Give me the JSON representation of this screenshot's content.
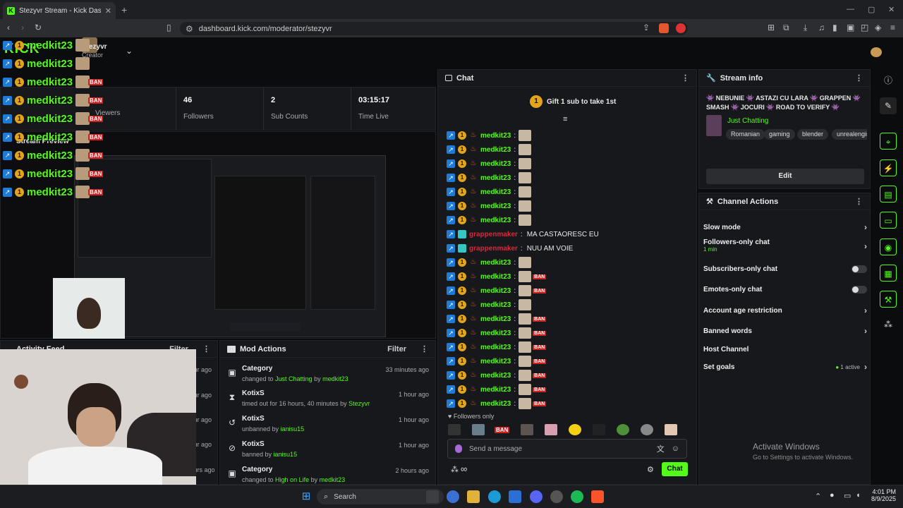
{
  "browser": {
    "tab_title": "Stezyvr Stream - Kick Dashboard",
    "url": "dashboard.kick.com/moderator/stezyvr"
  },
  "nav": {
    "username": "Stezyvr",
    "role": "Creator",
    "logo": "KICK"
  },
  "stats": [
    {
      "value": "",
      "label": "Viewers"
    },
    {
      "value": "46",
      "label": "Followers"
    },
    {
      "value": "2",
      "label": "Sub Counts"
    },
    {
      "value": "03:15:17",
      "label": "Time Live"
    }
  ],
  "stream_preview": {
    "title": "Stream Preview"
  },
  "overlay_chat": {
    "name": "medkit23",
    "count": 9
  },
  "chat": {
    "title": "Chat",
    "pinned": "Gift 1 sub to take 1st",
    "followers_only": "Followers only",
    "placeholder": "Send a message",
    "send_label": "Chat",
    "messages": [
      {
        "user": "medkit23",
        "text": "",
        "ban": false
      },
      {
        "user": "medkit23",
        "text": "",
        "ban": false
      },
      {
        "user": "medkit23",
        "text": "",
        "ban": false
      },
      {
        "user": "medkit23",
        "text": "",
        "ban": false
      },
      {
        "user": "medkit23",
        "text": "",
        "ban": false
      },
      {
        "user": "medkit23",
        "text": "",
        "ban": false
      },
      {
        "user": "medkit23",
        "text": "",
        "ban": false
      },
      {
        "user": "grappenmaker",
        "text": "MA CASTAORESC EU",
        "ban": false
      },
      {
        "user": "grappenmaker",
        "text": "NUU AM VOIE",
        "ban": false
      },
      {
        "user": "medkit23",
        "text": "",
        "ban": false
      },
      {
        "user": "medkit23",
        "text": "",
        "ban": true
      },
      {
        "user": "medkit23",
        "text": "",
        "ban": true
      },
      {
        "user": "medkit23",
        "text": "",
        "ban": false
      },
      {
        "user": "medkit23",
        "text": "",
        "ban": true
      },
      {
        "user": "medkit23",
        "text": "",
        "ban": true
      },
      {
        "user": "medkit23",
        "text": "",
        "ban": true
      },
      {
        "user": "medkit23",
        "text": "",
        "ban": true
      },
      {
        "user": "medkit23",
        "text": "",
        "ban": true
      },
      {
        "user": "medkit23",
        "text": "",
        "ban": true
      },
      {
        "user": "medkit23",
        "text": "",
        "ban": true
      }
    ]
  },
  "stream_info": {
    "title": "Stream info",
    "stream_title": "👾 NEBUNIE 👾 ASTAZI CU LARA 👾 GRAPPEN 👾 SMASH 👾 JOCURI 👾 ROAD TO VERIFY 👾",
    "category": "Just Chatting",
    "tags": [
      "Romanian",
      "gaming",
      "blender",
      "unrealengine"
    ],
    "edit_label": "Edit"
  },
  "channel_actions": {
    "title": "Channel Actions",
    "items": [
      {
        "label": "Slow mode",
        "sub": "",
        "control": "chevron"
      },
      {
        "label": "Followers-only chat",
        "sub": "1 min",
        "control": "chevron"
      },
      {
        "label": "Subscribers-only chat",
        "sub": "",
        "control": "toggle"
      },
      {
        "label": "Emotes-only chat",
        "sub": "",
        "control": "toggle"
      },
      {
        "label": "Account age restriction",
        "sub": "",
        "control": "chevron"
      },
      {
        "label": "Banned words",
        "sub": "",
        "control": "chevron"
      },
      {
        "label": "Host Channel",
        "sub": "",
        "control": "none"
      },
      {
        "label": "Set goals",
        "sub": "1 active",
        "control": "chevron"
      }
    ]
  },
  "activity_feed": {
    "title": "Activity Feed",
    "filter": "Filter",
    "times": [
      "1 hour ago",
      "1 hour ago",
      "1 hour ago",
      "1 hour ago",
      "1 hour ago",
      "2 hours ago"
    ]
  },
  "mod_actions": {
    "title": "Mod Actions",
    "filter": "Filter",
    "items": [
      {
        "title": "Category",
        "pre": "changed to ",
        "hl1": "Just Chatting",
        "mid": " by ",
        "hl2": "medkit23",
        "time": "33 minutes ago",
        "icon": "category-icon"
      },
      {
        "title": "KotixS",
        "pre": "timed out for 16 hours, 40 minutes by ",
        "hl1": "",
        "mid": "",
        "hl2": "Stezyvr",
        "time": "1 hour ago",
        "icon": "hourglass-icon"
      },
      {
        "title": "KotixS",
        "pre": "unbanned by ",
        "hl1": "",
        "mid": "",
        "hl2": "ianisu15",
        "time": "1 hour ago",
        "icon": "undo-icon"
      },
      {
        "title": "KotixS",
        "pre": "banned by ",
        "hl1": "",
        "mid": "",
        "hl2": "ianisu15",
        "time": "1 hour ago",
        "icon": "ban-icon"
      },
      {
        "title": "Category",
        "pre": "changed to ",
        "hl1": "High on Life",
        "mid": " by ",
        "hl2": "medkit23",
        "time": "2 hours ago",
        "icon": "category-icon"
      }
    ]
  },
  "watermark": {
    "line1": "Activate Windows",
    "line2": "Go to Settings to activate Windows."
  },
  "taskbar": {
    "search": "Search",
    "time": "4:01 PM",
    "date": "8/9/2025"
  },
  "colors": {
    "kick_green": "#53fc18",
    "panel": "#17181b",
    "ban_red": "#d21f1f",
    "grappen_red": "#e0243c"
  }
}
